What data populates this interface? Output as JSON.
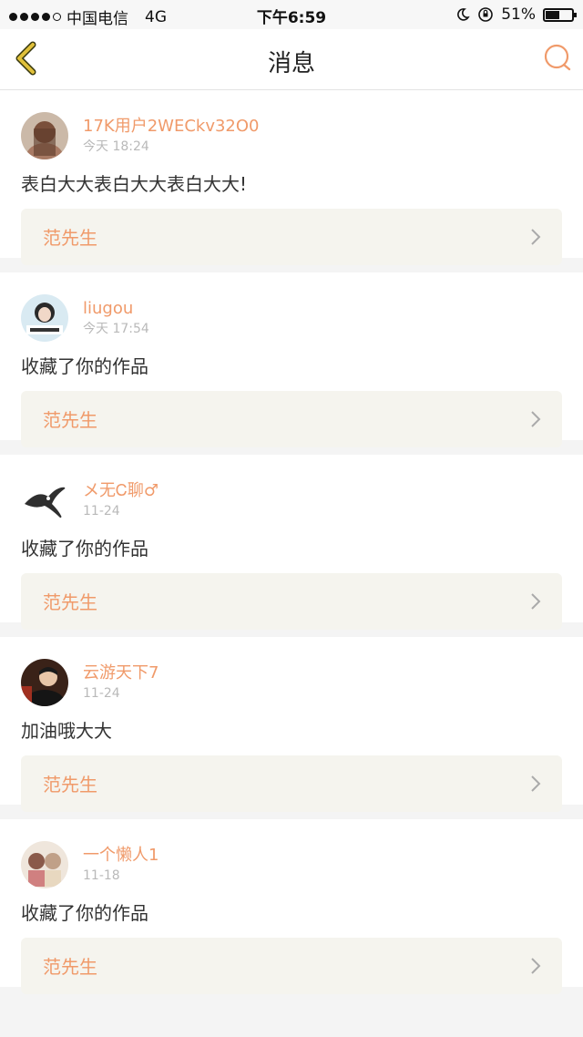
{
  "statusbar": {
    "carrier": "中国电信",
    "network": "4G",
    "time": "下午6:59",
    "battery": "51%"
  },
  "header": {
    "title": "消息",
    "back_icon": "chevron-left-icon",
    "search_icon": "search-icon"
  },
  "colors": {
    "accent": "#f09a6a",
    "back": "#d9b83a",
    "work_bg": "#f5f4ee"
  },
  "messages": [
    {
      "username": "17K用户2WECkv32O0",
      "time": "今天 18:24",
      "content": "表白大大表白大大表白大大!",
      "work": "范先生"
    },
    {
      "username": "liugou",
      "time": "今天 17:54",
      "content": "收藏了你的作品",
      "work": "范先生"
    },
    {
      "username": "メ无Ꮯ聊♂",
      "time": "11-24",
      "content": "收藏了你的作品",
      "work": "范先生"
    },
    {
      "username": "云游天下7",
      "time": "11-24",
      "content": "加油哦大大",
      "work": "范先生"
    },
    {
      "username": "一个懒人1",
      "time": "11-18",
      "content": "收藏了你的作品",
      "work": "范先生"
    }
  ]
}
